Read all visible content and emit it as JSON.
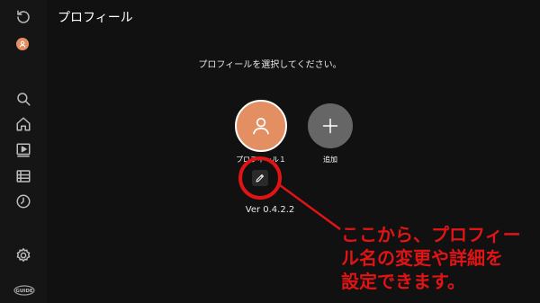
{
  "header": {
    "title": "プロフィール"
  },
  "sidebar": {
    "items": [
      {
        "name": "back",
        "icon": "refresh-back-icon"
      },
      {
        "name": "profile",
        "icon": "avatar-icon"
      },
      {
        "name": "search",
        "icon": "search-icon"
      },
      {
        "name": "home",
        "icon": "home-icon"
      },
      {
        "name": "video",
        "icon": "video-play-icon"
      },
      {
        "name": "list",
        "icon": "list-icon"
      },
      {
        "name": "history",
        "icon": "clock-history-icon"
      },
      {
        "name": "settings",
        "icon": "gear-icon"
      }
    ],
    "logo_text": "GUIDE"
  },
  "main": {
    "prompt": "プロフィールを選択してください。",
    "profiles": [
      {
        "label": "プロフィール１"
      }
    ],
    "add_label": "追加",
    "version": "Ver 0.4.2.2"
  },
  "annotation": {
    "lines": [
      "ここから、プロフィー",
      "ル名の変更や詳細を",
      "設定できます。"
    ],
    "color": "#e01414"
  },
  "colors": {
    "background": "#111111",
    "accent": "#e48f62",
    "add": "#666666"
  }
}
